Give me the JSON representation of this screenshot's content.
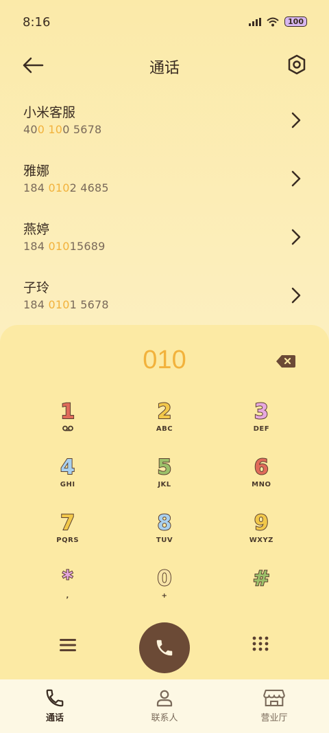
{
  "status": {
    "time": "8:16",
    "battery": "100"
  },
  "header": {
    "title": "通话"
  },
  "contacts": [
    {
      "name": "小米客服",
      "num_parts": [
        "40",
        "0 10",
        "0 5678"
      ]
    },
    {
      "name": "雅娜",
      "num_parts": [
        "184 ",
        "010",
        "2 4685"
      ]
    },
    {
      "name": "燕婷",
      "num_parts": [
        "184 ",
        "010",
        "15689"
      ]
    },
    {
      "name": "子玲",
      "num_parts": [
        "184 ",
        "010",
        "1 5678"
      ]
    }
  ],
  "dialpad": {
    "input": "010",
    "keys": [
      {
        "digit": "1",
        "letters": "",
        "color": "#e06b5a"
      },
      {
        "digit": "2",
        "letters": "ABC",
        "color": "#f2c84a"
      },
      {
        "digit": "3",
        "letters": "DEF",
        "color": "#e7a8df"
      },
      {
        "digit": "4",
        "letters": "GHI",
        "color": "#a9d0ee"
      },
      {
        "digit": "5",
        "letters": "JKL",
        "color": "#9cc06a"
      },
      {
        "digit": "6",
        "letters": "MNO",
        "color": "#e06b5a"
      },
      {
        "digit": "7",
        "letters": "PQRS",
        "color": "#f2c84a"
      },
      {
        "digit": "8",
        "letters": "TUV",
        "color": "#a9d0ee"
      },
      {
        "digit": "9",
        "letters": "WXYZ",
        "color": "#f2c84a"
      },
      {
        "digit": "*",
        "letters": ",",
        "color": "#e7a8df"
      },
      {
        "digit": "0",
        "letters": "+",
        "color": "#f7e4a8"
      },
      {
        "digit": "#",
        "letters": "",
        "color": "#9cc06a"
      }
    ]
  },
  "nav": {
    "calls": "通话",
    "contacts": "联系人",
    "store": "营业厅"
  },
  "colors": {
    "accent": "#f2b23c",
    "call_button": "#6b4a36"
  }
}
